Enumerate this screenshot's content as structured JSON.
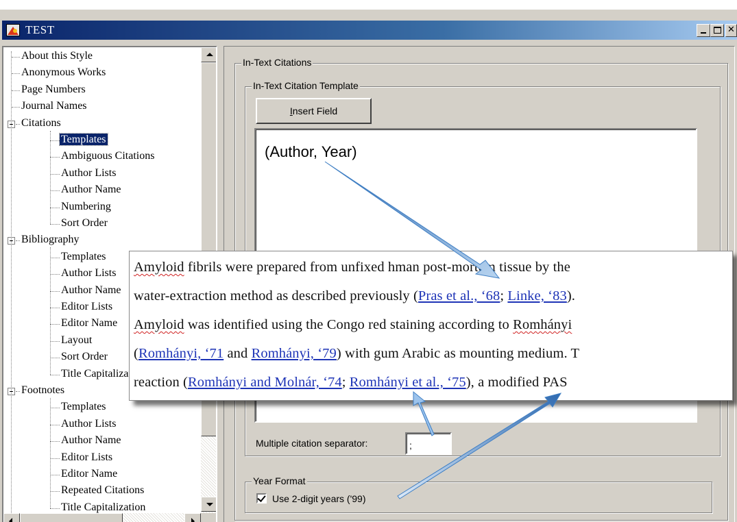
{
  "window": {
    "title": "TEST"
  },
  "tree": {
    "items": [
      {
        "label": "About this Style",
        "level": 0
      },
      {
        "label": "Anonymous Works",
        "level": 0
      },
      {
        "label": "Page Numbers",
        "level": 0
      },
      {
        "label": "Journal Names",
        "level": 0
      },
      {
        "label": "Citations",
        "level": 0,
        "expanded": true
      },
      {
        "label": "Templates",
        "level": 1,
        "selected": true
      },
      {
        "label": "Ambiguous Citations",
        "level": 1
      },
      {
        "label": "Author Lists",
        "level": 1
      },
      {
        "label": "Author Name",
        "level": 1
      },
      {
        "label": "Numbering",
        "level": 1
      },
      {
        "label": "Sort Order",
        "level": 1
      },
      {
        "label": "Bibliography",
        "level": 0,
        "expanded": true
      },
      {
        "label": "Templates",
        "level": 1
      },
      {
        "label": "Author Lists",
        "level": 1
      },
      {
        "label": "Author Name",
        "level": 1
      },
      {
        "label": "Editor Lists",
        "level": 1
      },
      {
        "label": "Editor Name",
        "level": 1
      },
      {
        "label": "Layout",
        "level": 1
      },
      {
        "label": "Sort Order",
        "level": 1
      },
      {
        "label": "Title Capitalization",
        "level": 1
      },
      {
        "label": "Footnotes",
        "level": 0,
        "expanded": true
      },
      {
        "label": "Templates",
        "level": 1
      },
      {
        "label": "Author Lists",
        "level": 1
      },
      {
        "label": "Author Name",
        "level": 1
      },
      {
        "label": "Editor Lists",
        "level": 1
      },
      {
        "label": "Editor Name",
        "level": 1
      },
      {
        "label": "Repeated Citations",
        "level": 1
      },
      {
        "label": "Title Capitalization",
        "level": 1
      }
    ]
  },
  "panel": {
    "outer_group": "In-Text Citations",
    "inner_group": "In-Text Citation Template",
    "insert_field_prefix": "",
    "insert_field_mnemonic": "I",
    "insert_field_rest": "nsert Field",
    "template_text": "(Author, Year)",
    "separator_label": "Multiple citation separator:",
    "separator_value": ";",
    "year_group": "Year Format",
    "year_checkbox_label": "Use 2-digit years ('99)",
    "year_checkbox_checked": true
  },
  "callout": {
    "line1_a": "Amyloid",
    "line1_b": " fibrils were prepared from unfixed h",
    "line1_c": "man post-mortem tissue by the",
    "line2_a": "water-extraction method as described previously (",
    "line2_cite1": "Pras et al., ‘68",
    "line2_sep": "; ",
    "line2_cite2": "Linke, ‘83",
    "line2_end": ").",
    "line3_a": "Amyloid",
    "line3_b": " was identified using the Congo red staining according to ",
    "line3_c": "Romhányi",
    "line4_a": "(",
    "line4_cite1": "Romhányi, ‘71",
    "line4_b": " and ",
    "line4_cite2": "Romhányi, ‘79",
    "line4_c": ") with gum Arabic as mounting medium. T",
    "line5_a": "reaction (",
    "line5_cite1": "Romhányi and Molnár, ‘74",
    "line5_sep": "; ",
    "line5_cite2": "Romhányi et al., ‘75",
    "line5_end": "), a modified PAS"
  },
  "colors": {
    "title_bar": "#0a246a",
    "citation_link": "#1d33b6",
    "arrow": "#4a86c8"
  }
}
